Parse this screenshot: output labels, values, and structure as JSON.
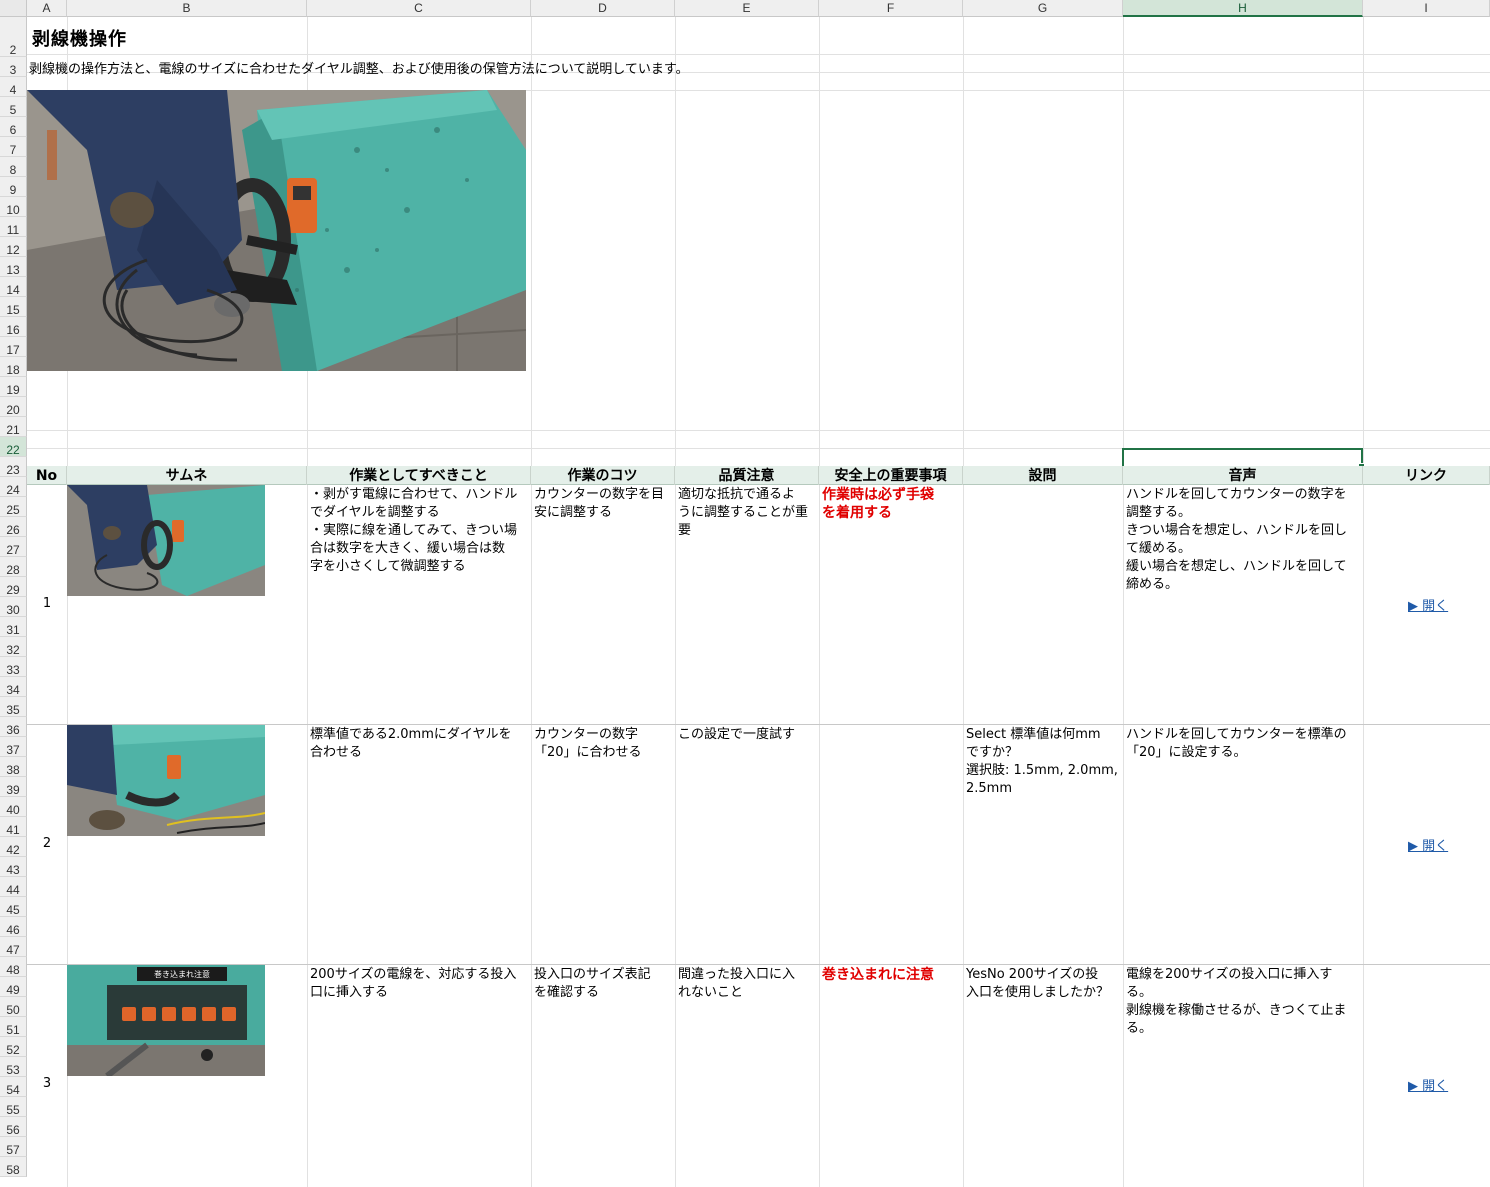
{
  "columns": [
    "A",
    "B",
    "C",
    "D",
    "E",
    "F",
    "G",
    "H",
    "I"
  ],
  "selected_column": "H",
  "rows": [
    "1",
    "2",
    "3",
    "4",
    "5",
    "6",
    "7",
    "8",
    "9",
    "10",
    "11",
    "12",
    "13",
    "14",
    "15",
    "16",
    "17",
    "18",
    "19",
    "20",
    "21",
    "22",
    "23",
    "24",
    "25",
    "26",
    "27",
    "28",
    "29",
    "30",
    "31",
    "32",
    "33",
    "34",
    "35",
    "36",
    "37",
    "38",
    "39",
    "40",
    "41",
    "42",
    "43",
    "44",
    "45",
    "46",
    "47",
    "48",
    "49",
    "50",
    "51",
    "52",
    "53",
    "54",
    "55",
    "56",
    "57",
    "58"
  ],
  "selected_row": "22",
  "title": "剥線機操作",
  "description": "剥線機の操作方法と、電線のサイズに合わせたダイヤル調整、および使用後の保管方法について説明しています。",
  "table_headers": {
    "no": "No",
    "thumb": "サムネ",
    "task": "作業としてすべきこと",
    "tips": "作業のコツ",
    "quality": "品質注意",
    "safety": "安全上の重要事項",
    "question": "設問",
    "audio": "音声",
    "link": "リンク"
  },
  "steps": [
    {
      "no": "1",
      "task": [
        "・剥がす電線に合わせて、ハンドル",
        "でダイヤルを調整する",
        "・実際に線を通してみて、きつい場",
        "合は数字を大きく、緩い場合は数",
        "字を小さくして微調整する"
      ],
      "tips": [
        "カウンターの数字を目",
        "安に調整する"
      ],
      "quality": [
        "適切な抵抗で通るよ",
        "うに調整することが重",
        "要"
      ],
      "safety": [
        "作業時は必ず手袋",
        "を着用する"
      ],
      "question": [],
      "audio": [
        "ハンドルを回してカウンターの数字を",
        "調整する。",
        "きつい場合を想定し、ハンドルを回し",
        "て緩める。",
        "緩い場合を想定し、ハンドルを回して",
        "締める。"
      ],
      "link": "▶ 開く"
    },
    {
      "no": "2",
      "task": [
        "標準値である2.0mmにダイヤルを",
        "合わせる"
      ],
      "tips": [
        "カウンターの数字",
        "「20」に合わせる"
      ],
      "quality": [
        "この設定で一度試す"
      ],
      "safety": [],
      "question": [
        "Select 標準値は何mm",
        "ですか？",
        "選択肢: 1.5mm, 2.0mm,",
        "2.5mm"
      ],
      "audio": [
        "ハンドルを回してカウンターを標準の",
        "「20」に設定する。"
      ],
      "link": "▶ 開く"
    },
    {
      "no": "3",
      "task": [
        "200サイズの電線を、対応する投入",
        "口に挿入する"
      ],
      "tips": [
        "投入口のサイズ表記",
        "を確認する"
      ],
      "quality": [
        "間違った投入口に入",
        "れないこと"
      ],
      "safety": [
        "巻き込まれに注意"
      ],
      "question": [
        "YesNo 200サイズの投",
        "入口を使用しましたか？"
      ],
      "audio": [
        "電線を200サイズの投入口に挿入す",
        "る。",
        "剥線機を稼働させるが、きつくて止ま",
        "る。"
      ],
      "link": "▶ 開く"
    }
  ],
  "thumb3_overlay": "巻き込まれ注意"
}
